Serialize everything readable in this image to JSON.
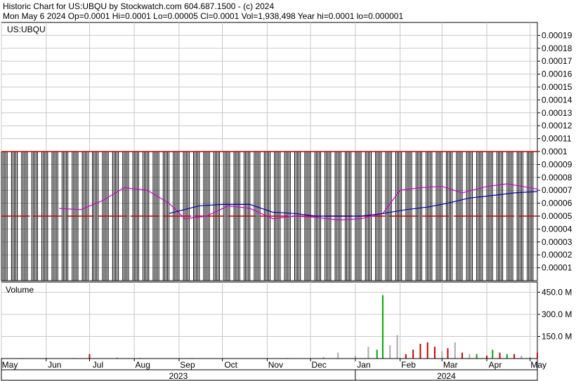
{
  "header": {
    "line1": "Historic Chart for US:UBQU by Stockwatch.com 604.687.1500 - (c) 2024",
    "line2": "Mon May  6 2024   Op=0.0001   Hi=0.0001   Lo=0.00005   Cl=0.0001   Vol=1,938,498   Year hi=0.0001   lo=0.000001"
  },
  "colors": {
    "background": "#ffffff",
    "frame": "#000000",
    "grid": "#c8c8c8",
    "price_bar": "#000000",
    "price_extreme": "#cc0000",
    "ma_short": "#cc00cc",
    "ma_long": "#0000aa",
    "vol_up": "#00aa00",
    "vol_down": "#cc0000",
    "vol_flat": "#aaaaaa"
  },
  "chart_data": [
    {
      "type": "line",
      "title": "US:UBQU",
      "ylim": [
        0,
        0.0002
      ],
      "y_ticks": [
        "0.00001",
        "0.00002",
        "0.00003",
        "0.00004",
        "0.00005",
        "0.00006",
        "0.00007",
        "0.00008",
        "0.00009",
        "0.0001",
        "0.00011",
        "0.00012",
        "0.00013",
        "0.00014",
        "0.00015",
        "0.00016",
        "0.00017",
        "0.00018",
        "0.00019"
      ],
      "bar_range_high": 0.0001,
      "bar_range_low": 0.0,
      "bar_close_level": 5e-05,
      "ma_short": {
        "x": [
          "2023-06-10",
          "2023-06-25",
          "2023-07-10",
          "2023-07-25",
          "2023-08-10",
          "2023-08-25",
          "2023-09-05",
          "2023-09-20",
          "2023-10-05",
          "2023-10-20",
          "2023-11-05",
          "2023-11-20",
          "2023-12-05",
          "2023-12-20",
          "2024-01-05",
          "2024-01-20",
          "2024-02-01",
          "2024-02-15",
          "2024-03-01",
          "2024-03-15",
          "2024-04-01",
          "2024-04-15",
          "2024-05-06"
        ],
        "values": [
          5.6e-05,
          5.5e-05,
          6.2e-05,
          7.2e-05,
          7e-05,
          6e-05,
          4.8e-05,
          5e-05,
          5.8e-05,
          5.6e-05,
          4.8e-05,
          5e-05,
          4.9e-05,
          4.7e-05,
          4.8e-05,
          5.2e-05,
          7e-05,
          7.2e-05,
          7.3e-05,
          6.8e-05,
          7.3e-05,
          7.5e-05,
          7.1e-05
        ]
      },
      "ma_long": {
        "x": [
          "2023-08-25",
          "2023-09-15",
          "2023-10-01",
          "2023-10-20",
          "2023-11-05",
          "2023-11-20",
          "2023-12-05",
          "2023-12-20",
          "2024-01-05",
          "2024-01-20",
          "2024-02-05",
          "2024-02-20",
          "2024-03-05",
          "2024-03-20",
          "2024-04-05",
          "2024-04-20",
          "2024-05-06"
        ],
        "values": [
          5.2e-05,
          5.8e-05,
          5.9e-05,
          5.9e-05,
          5.3e-05,
          5.2e-05,
          5e-05,
          5e-05,
          5e-05,
          5.2e-05,
          5.5e-05,
          5.7e-05,
          6e-05,
          6.4e-05,
          6.6e-05,
          6.8e-05,
          6.9e-05
        ]
      }
    },
    {
      "type": "bar",
      "title": "Volume",
      "ylim": [
        0,
        500
      ],
      "y_ticks": [
        "150.0 M",
        "300.0 M",
        "450.0 M"
      ],
      "x": [
        "2023-05-15",
        "2023-06-01",
        "2023-06-20",
        "2023-07-01",
        "2023-07-20",
        "2023-08-05",
        "2023-09-10",
        "2023-11-15",
        "2023-12-10",
        "2023-12-20",
        "2024-01-01",
        "2024-01-10",
        "2024-01-16",
        "2024-01-20",
        "2024-01-25",
        "2024-01-30",
        "2024-02-05",
        "2024-02-10",
        "2024-02-15",
        "2024-02-20",
        "2024-02-25",
        "2024-03-01",
        "2024-03-05",
        "2024-03-10",
        "2024-03-15",
        "2024-03-20",
        "2024-03-25",
        "2024-04-01",
        "2024-04-05",
        "2024-04-10",
        "2024-04-15",
        "2024-04-20",
        "2024-04-25",
        "2024-05-01",
        "2024-05-06"
      ],
      "values": [
        3,
        6,
        4,
        30,
        8,
        5,
        4,
        4,
        10,
        40,
        20,
        80,
        60,
        430,
        90,
        160,
        30,
        60,
        100,
        110,
        80,
        50,
        70,
        110,
        40,
        30,
        30,
        20,
        60,
        40,
        30,
        30,
        20,
        10,
        40
      ],
      "direction": [
        "up",
        "flat",
        "flat",
        "down",
        "flat",
        "flat",
        "flat",
        "flat",
        "flat",
        "flat",
        "flat",
        "flat",
        "up",
        "up",
        "flat",
        "flat",
        "down",
        "down",
        "down",
        "down",
        "down",
        "flat",
        "down",
        "flat",
        "down",
        "flat",
        "up",
        "down",
        "up",
        "down",
        "up",
        "down",
        "flat",
        "flat",
        "down"
      ]
    }
  ],
  "x_axis": {
    "months": [
      {
        "label": "May",
        "date": "2023-05-01"
      },
      {
        "label": "Jun",
        "date": "2023-06-01"
      },
      {
        "label": "Jul",
        "date": "2023-07-01"
      },
      {
        "label": "Aug",
        "date": "2023-08-01"
      },
      {
        "label": "Sep",
        "date": "2023-09-01"
      },
      {
        "label": "Oct",
        "date": "2023-10-01"
      },
      {
        "label": "Nov",
        "date": "2023-11-01"
      },
      {
        "label": "Dec",
        "date": "2023-12-01"
      },
      {
        "label": "Jan",
        "date": "2024-01-01"
      },
      {
        "label": "Feb",
        "date": "2024-02-01"
      },
      {
        "label": "Mar",
        "date": "2024-03-01"
      },
      {
        "label": "Apr",
        "date": "2024-04-01"
      },
      {
        "label": "May",
        "date": "2024-05-01"
      }
    ],
    "years": [
      {
        "label": "2023",
        "from": "2023-05-01",
        "to": "2024-01-01"
      },
      {
        "label": "2024",
        "from": "2024-01-01",
        "to": "2024-05-06"
      }
    ],
    "range": [
      "2023-05-01",
      "2024-05-06"
    ]
  }
}
